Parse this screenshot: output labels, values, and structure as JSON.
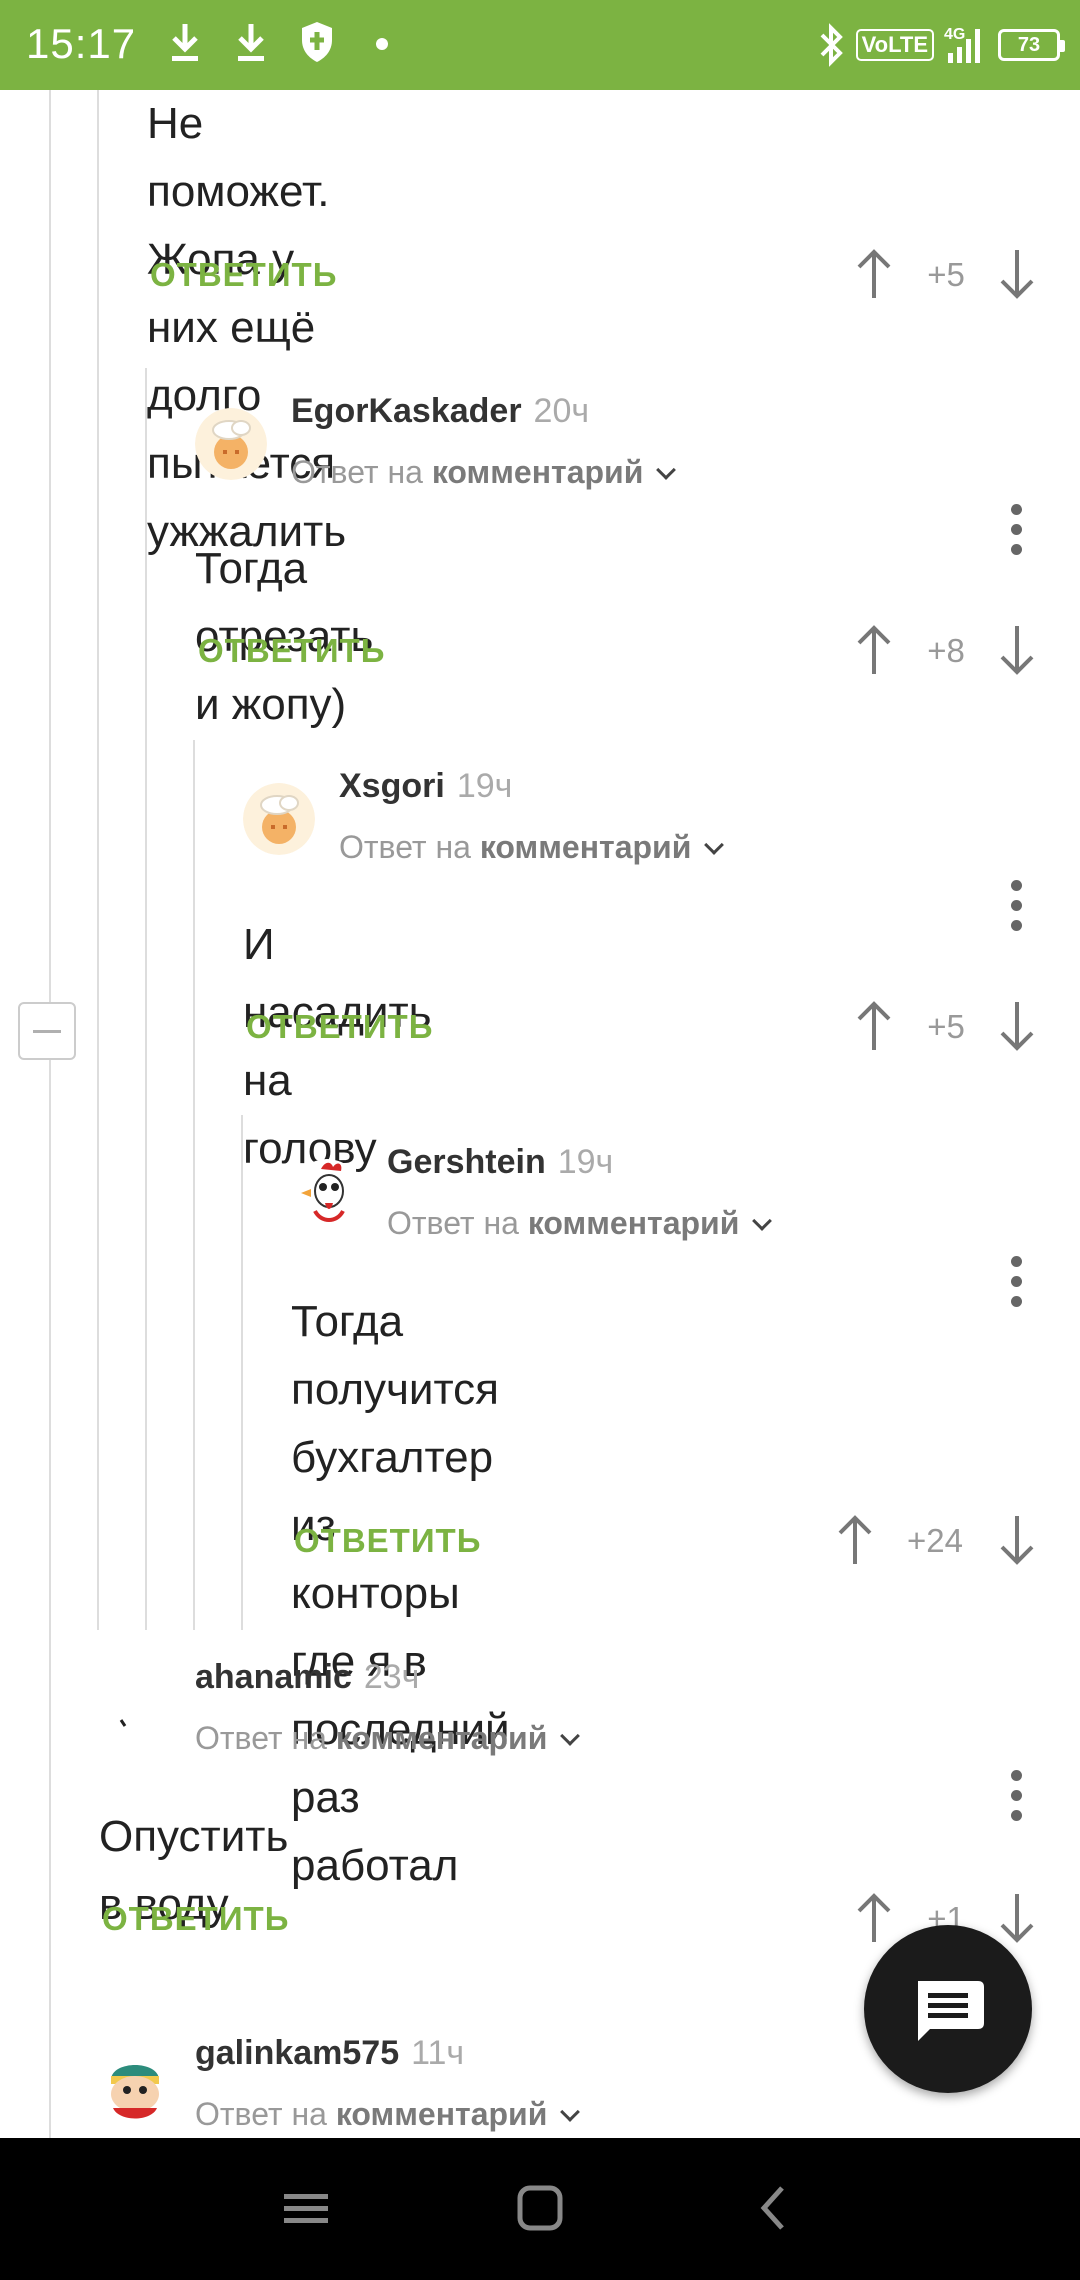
{
  "status_bar": {
    "time": "15:17",
    "battery": "73",
    "network": "4G",
    "volte": "VoLTE",
    "icons": [
      "download-icon",
      "download-icon",
      "shield-icon",
      "dot-icon",
      "bluetooth-icon",
      "volte-icon",
      "signal-icon",
      "battery-icon"
    ]
  },
  "colors": {
    "status_bar_bg": "#7cb342",
    "accent": "#7cb342",
    "fab_bg": "#1b1b1b",
    "nav_bg": "#000000"
  },
  "comments": [
    {
      "text_lines": [
        "Не поможет. Жопа у них ещё долго",
        "пытается ужжалить"
      ],
      "reply_label": "ОТВЕТИТЬ",
      "score": "+5"
    },
    {
      "username": "EgorKaskader",
      "time_ago": "20ч",
      "reply_prefix": "Ответ на",
      "reply_target": "комментарий",
      "text_lines": [
        "Тогда отрезать и жопу)"
      ],
      "reply_label": "ОТВЕТИТЬ",
      "score": "+8"
    },
    {
      "username": "Xsgori",
      "time_ago": "19ч",
      "reply_prefix": "Ответ на",
      "reply_target": "комментарий",
      "text_lines": [
        "И насадить на голову"
      ],
      "reply_label": "ОТВЕТИТЬ",
      "score": "+5"
    },
    {
      "username": "Gershtein",
      "time_ago": "19ч",
      "reply_prefix": "Ответ на",
      "reply_target": "комментарий",
      "text_lines": [
        "Тогда получится бухгалтер из",
        "конторы где я в последний раз",
        "работал"
      ],
      "reply_label": "ОТВЕТИТЬ",
      "score": "+24"
    },
    {
      "username": "ahanamic",
      "time_ago": "23ч",
      "reply_prefix": "Ответ на",
      "reply_target": "комментарий",
      "text_lines": [
        "Опустить в воду"
      ],
      "reply_label": "ОТВЕТИТЬ",
      "score": "+1"
    },
    {
      "username": "galinkam575",
      "time_ago": "11ч",
      "reply_prefix": "Ответ на",
      "reply_target": "комментарий"
    }
  ],
  "fab": {
    "icon": "chat-icon"
  },
  "nav_bar": {
    "icons": [
      "menu-icon",
      "home-icon",
      "back-icon"
    ]
  }
}
